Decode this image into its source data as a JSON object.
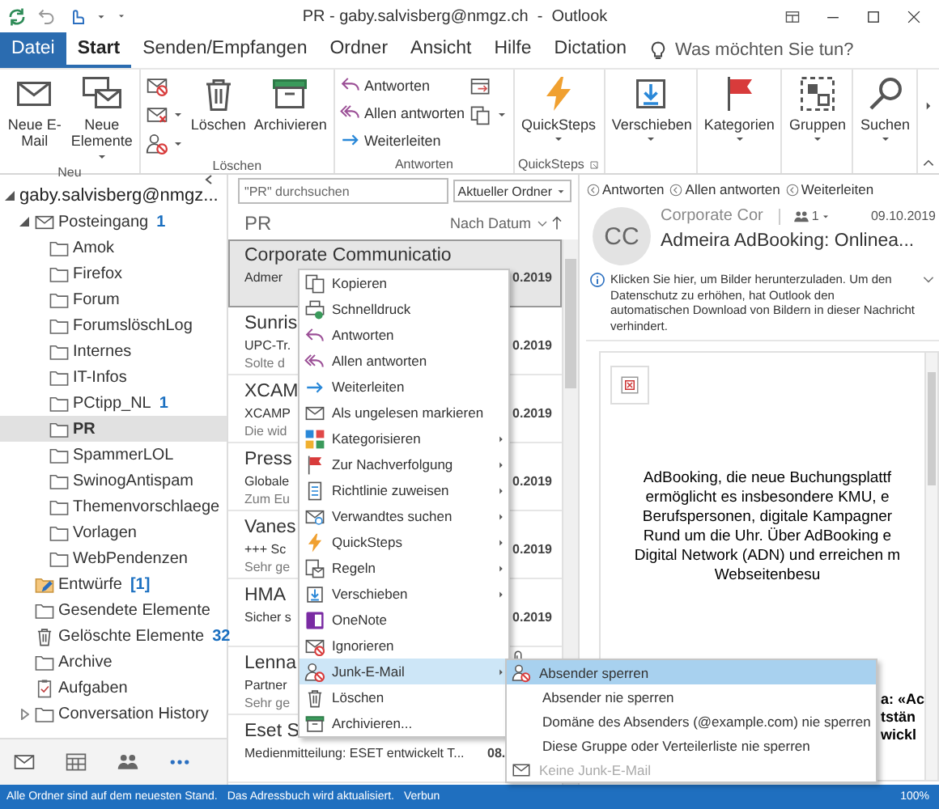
{
  "window": {
    "title": "PR - gaby.salvisberg@nmgz.ch  -  Outlook"
  },
  "ribbon_tabs": [
    {
      "label": "Datei",
      "kind": "file",
      "selected": false
    },
    {
      "label": "Start",
      "kind": "tab",
      "selected": true
    },
    {
      "label": "Senden/Empfangen",
      "kind": "tab",
      "selected": false
    },
    {
      "label": "Ordner",
      "kind": "tab",
      "selected": false
    },
    {
      "label": "Ansicht",
      "kind": "tab",
      "selected": false
    },
    {
      "label": "Hilfe",
      "kind": "tab",
      "selected": false
    },
    {
      "label": "Dictation",
      "kind": "tab",
      "selected": false
    }
  ],
  "tell_me": {
    "placeholder": "Was möchten Sie tun?"
  },
  "ribbon": {
    "groups": [
      {
        "label": "Neu",
        "launcher": false,
        "items": [
          {
            "kind": "large",
            "label": "Neue E-Mail",
            "dropdown": false
          },
          {
            "kind": "large",
            "label": "Neue Elemente",
            "dropdown": true
          }
        ]
      },
      {
        "label": "Löschen",
        "launcher": false,
        "items": [
          {
            "kind": "icon",
            "dropdown": false
          },
          {
            "kind": "icon",
            "dropdown": true
          },
          {
            "kind": "icon",
            "dropdown": true
          },
          {
            "kind": "large",
            "label": "Löschen",
            "dropdown": false
          },
          {
            "kind": "large",
            "label": "Archivieren",
            "dropdown": false
          }
        ]
      },
      {
        "label": "Antworten",
        "launcher": false,
        "items": [
          {
            "kind": "small",
            "label": "Antworten",
            "dropdown": false
          },
          {
            "kind": "small",
            "label": "Allen antworten",
            "dropdown": false
          },
          {
            "kind": "small",
            "label": "Weiterleiten",
            "dropdown": false
          },
          {
            "kind": "icon",
            "dropdown": false
          },
          {
            "kind": "icon",
            "dropdown": true
          }
        ]
      },
      {
        "label": "QuickSteps",
        "launcher": true,
        "items": [
          {
            "kind": "large",
            "label": "QuickSteps",
            "dropdown": true
          }
        ]
      },
      {
        "launcher": false,
        "items": [
          {
            "kind": "large",
            "label": "Verschieben",
            "dropdown": true
          }
        ]
      },
      {
        "launcher": false,
        "items": [
          {
            "kind": "large",
            "label": "Kategorien",
            "dropdown": true
          }
        ]
      },
      {
        "launcher": false,
        "items": [
          {
            "kind": "large",
            "label": "Gruppen",
            "dropdown": true
          }
        ]
      },
      {
        "launcher": false,
        "items": [
          {
            "kind": "large",
            "label": "Suchen",
            "dropdown": true
          }
        ]
      }
    ]
  },
  "folders": [
    {
      "label": "gaby.salvisberg@nmgz...",
      "kind": "account",
      "expanded": true,
      "selected": false,
      "children": [
        {
          "label": "Posteingang",
          "kind": "inbox",
          "count": "1",
          "expanded": true,
          "selected": false,
          "children": [
            {
              "label": "Amok",
              "kind": "folder",
              "selected": false
            },
            {
              "label": "Firefox",
              "kind": "folder",
              "selected": false
            },
            {
              "label": "Forum",
              "kind": "folder",
              "selected": false
            },
            {
              "label": "ForumslöschLog",
              "kind": "folder",
              "selected": false
            },
            {
              "label": "Internes",
              "kind": "folder",
              "selected": false
            },
            {
              "label": "IT-Infos",
              "kind": "folder",
              "selected": false
            },
            {
              "label": "PCtipp_NL",
              "kind": "folder",
              "count": "1",
              "selected": false
            },
            {
              "label": "PR",
              "kind": "folder",
              "selected": true
            },
            {
              "label": "SpammerLOL",
              "kind": "folder",
              "selected": false
            },
            {
              "label": "SwinogAntispam",
              "kind": "folder",
              "selected": false
            },
            {
              "label": "Themenvorschlaege",
              "kind": "folder",
              "selected": false
            },
            {
              "label": "Vorlagen",
              "kind": "folder",
              "selected": false
            },
            {
              "label": "WebPendenzen",
              "kind": "folder",
              "selected": false
            }
          ]
        },
        {
          "label": "Entwürfe",
          "kind": "drafts",
          "count": "[1]",
          "selected": false
        },
        {
          "label": "Gesendete Elemente",
          "kind": "folder",
          "selected": false
        },
        {
          "label": "Gelöschte Elemente",
          "kind": "trash",
          "count": "32",
          "selected": false
        },
        {
          "label": "Archive",
          "kind": "folder",
          "selected": false
        },
        {
          "label": "Aufgaben",
          "kind": "tasks",
          "selected": false
        },
        {
          "label": "Conversation History",
          "kind": "folder",
          "expanded": false,
          "selected": false
        }
      ]
    }
  ],
  "message_list": {
    "search": {
      "placeholder": "\"PR\" durchsuchen"
    },
    "scope": "Aktueller Ordner",
    "heading": "PR",
    "sort": "Nach Datum",
    "rows": [
      {
        "sender": "Corporate Communicatio",
        "subject": "Admer",
        "date": "0.2019",
        "date_left_aligned": false,
        "selected": true,
        "attachment": false
      },
      {
        "sender": "Sunris",
        "subject": "UPC-Tr.",
        "preview": "Solte d",
        "date": "0.2019",
        "date_left_aligned": false,
        "selected": false,
        "attachment": false
      },
      {
        "sender": "XCAM",
        "subject": "XCAMP",
        "preview": "Die wid",
        "date": "0.2019",
        "date_left_aligned": false,
        "selected": false,
        "attachment": false
      },
      {
        "sender": "Press",
        "subject": "Globale",
        "preview": "Zum Eu",
        "date": "0.2019",
        "date_left_aligned": false,
        "selected": false,
        "attachment": false
      },
      {
        "sender": "Vanes",
        "subject": "+++ Sc",
        "preview": "Sehr ge",
        "date": "0.2019",
        "date_left_aligned": false,
        "selected": false,
        "attachment": false
      },
      {
        "sender": "HMA",
        "subject": "Sicher s",
        "date": "0.2019",
        "date_left_aligned": false,
        "selected": false,
        "attachment": false
      },
      {
        "sender": "Lenna",
        "subject": "Partner",
        "preview": "Sehr ge",
        "selected": false,
        "attachment": true
      },
      {
        "sender": "Eset S",
        "subject": "Medienmitteilung: ESET entwickelt T...",
        "date": "08.",
        "date_left_aligned": true,
        "selected": false,
        "attachment": false
      }
    ]
  },
  "reading_pane": {
    "actions": [
      "Antworten",
      "Allen antworten",
      "Weiterleiten"
    ],
    "avatar": "CC",
    "sender": "Corporate Cor",
    "recipients": "1",
    "date": "09.10.2019",
    "subject": "Admeira AdBooking: Onlinea...",
    "info": "Klicken Sie hier, um Bilder herunterzuladen. Um den Datenschutz zu erhöhen, hat Outlook den automatischen Download von Bildern in dieser Nachricht verhindert.",
    "body": "AdBooking, die neue Buchungsplattf\nermöglicht es insbesondere KMU, e\nBerufspersonen, digitale Kampagner\nRund um die Uhr. Über AdBooking e\nDigital Network (ADN) und erreichen m\nWebseitenbesu",
    "body_2": "a: «Ac\ntstän\nwickl"
  },
  "context_menu": {
    "items": [
      {
        "label": "Kopieren",
        "submenu": false,
        "selected": false
      },
      {
        "label": "Schnelldruck",
        "submenu": false,
        "selected": false
      },
      {
        "label": "Antworten",
        "submenu": false,
        "selected": false
      },
      {
        "label": "Allen antworten",
        "submenu": false,
        "selected": false
      },
      {
        "label": "Weiterleiten",
        "submenu": false,
        "selected": false
      },
      {
        "label": "Als ungelesen markieren",
        "submenu": false,
        "selected": false
      },
      {
        "label": "Kategorisieren",
        "submenu": true,
        "selected": false
      },
      {
        "label": "Zur Nachverfolgung",
        "submenu": true,
        "selected": false
      },
      {
        "label": "Richtlinie zuweisen",
        "submenu": true,
        "selected": false
      },
      {
        "label": "Verwandtes suchen",
        "submenu": true,
        "selected": false
      },
      {
        "label": "QuickSteps",
        "submenu": true,
        "selected": false
      },
      {
        "label": "Regeln",
        "submenu": true,
        "selected": false
      },
      {
        "label": "Verschieben",
        "submenu": true,
        "selected": false
      },
      {
        "label": "OneNote",
        "submenu": false,
        "selected": false
      },
      {
        "label": "Ignorieren",
        "submenu": false,
        "selected": false
      },
      {
        "label": "Junk-E-Mail",
        "submenu": true,
        "selected": true
      },
      {
        "label": "Löschen",
        "submenu": false,
        "selected": false
      },
      {
        "label": "Archivieren...",
        "submenu": false,
        "selected": false
      }
    ]
  },
  "junk_submenu": {
    "items": [
      {
        "label": "Absender sperren",
        "selected": true,
        "disabled": false
      },
      {
        "label": "Absender nie sperren",
        "selected": false,
        "disabled": false
      },
      {
        "label": "Domäne des Absenders (@example.com) nie sperren",
        "selected": false,
        "disabled": false
      },
      {
        "label": "Diese Gruppe oder Verteilerliste nie sperren",
        "selected": false,
        "disabled": false
      },
      {
        "label": "Keine Junk-E-Mail",
        "selected": false,
        "disabled": true
      }
    ]
  },
  "status_bar": {
    "items": [
      "Alle Ordner sind auf dem neuesten Stand.",
      "Das Adressbuch wird aktualisiert.",
      "Verbun"
    ],
    "zoom": "100%"
  }
}
